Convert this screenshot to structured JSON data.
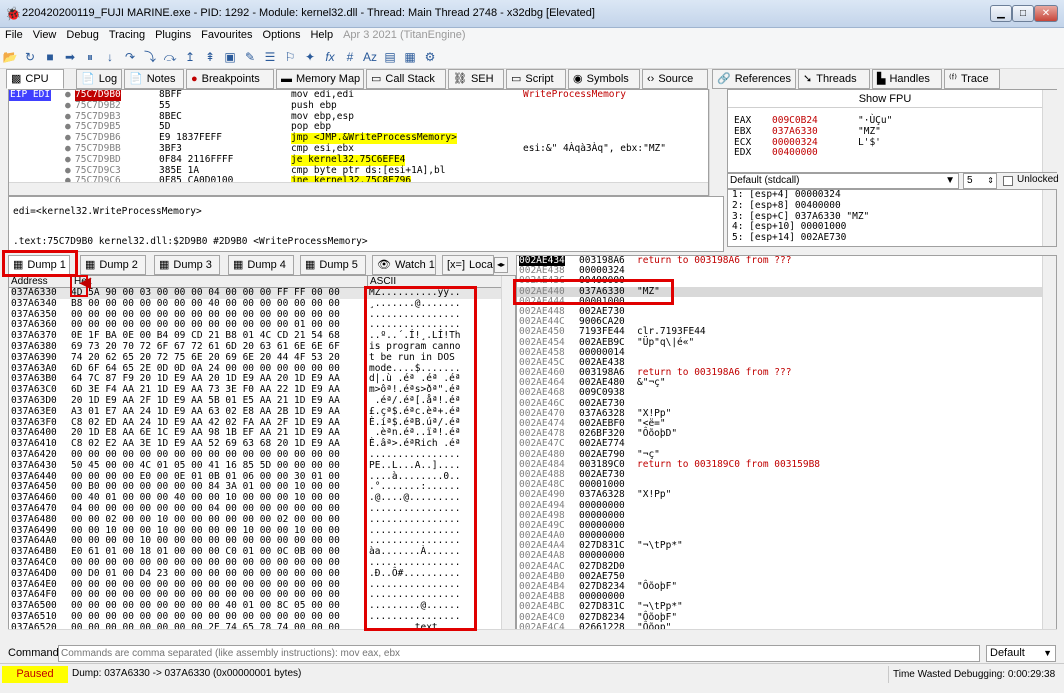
{
  "window": {
    "title": "220420200119_FUJI MARINE.exe - PID: 1292 - Module: kernel32.dll - Thread: Main Thread 2748 - x32dbg [Elevated]"
  },
  "menu": [
    "File",
    "View",
    "Debug",
    "Tracing",
    "Plugins",
    "Favourites",
    "Options",
    "Help"
  ],
  "menu_date": "Apr 3 2021 (TitanEngine)",
  "tabs": [
    "CPU",
    "Log",
    "Notes",
    "Breakpoints",
    "Memory Map",
    "Call Stack",
    "SEH",
    "Script",
    "Symbols",
    "Source",
    "References",
    "Threads",
    "Handles",
    "Trace"
  ],
  "disasm": [
    {
      "addr": "75C7D9B0",
      "bytes": "8BFF",
      "ins": "mov edi,edi",
      "comment": "WriteProcessMemory"
    },
    {
      "addr": "75C7D9B2",
      "bytes": "55",
      "ins": "push ebp",
      "comment": ""
    },
    {
      "addr": "75C7D9B3",
      "bytes": "8BEC",
      "ins": "mov ebp,esp",
      "comment": ""
    },
    {
      "addr": "75C7D9B5",
      "bytes": "5D",
      "ins": "pop ebp",
      "comment": ""
    },
    {
      "addr": "75C7D9B6",
      "bytes": "E9 1837FEFF",
      "ins": "jmp <JMP.&WriteProcessMemory>",
      "comment": ""
    },
    {
      "addr": "75C7D9BB",
      "bytes": "3BF3",
      "ins": "cmp esi,ebx",
      "comment": "esi:&\" 4Àqà3Àq\", ebx:\"MZ\""
    },
    {
      "addr": "75C7D9BD",
      "bytes": "0F84 2116FFFF",
      "ins": "je kernel32.75C6EFE4",
      "comment": ""
    },
    {
      "addr": "75C7D9C3",
      "bytes": "385E 1A",
      "ins": "cmp byte ptr ds:[esi+1A],bl",
      "comment": ""
    },
    {
      "addr": "75C7D9C6",
      "bytes": "0F85 CA0D0100",
      "ins": "jne kernel32.75C8E796",
      "comment": ""
    },
    {
      "addr": "75C7D9CC",
      "bytes": "FF76 14",
      "ins": "push dword ptr ds:[esi+14]",
      "comment": ""
    }
  ],
  "eip_label": "EIP EDI",
  "info_line1": "edi=<kernel32.WriteProcessMemory>",
  "info_line2": ".text:75C7D9B0 kernel32.dll:$2D9B0 #2D9B0 <WriteProcessMemory>",
  "regs": {
    "show_fpu": "Show FPU",
    "rows": [
      {
        "n": "EAX",
        "v": "009C0B24",
        "c": "\"·ÙÇu\""
      },
      {
        "n": "EBX",
        "v": "037A6330",
        "c": "\"MZ\""
      },
      {
        "n": "ECX",
        "v": "00000324",
        "c": "L'$'"
      },
      {
        "n": "EDX",
        "v": "00400000",
        "c": ""
      }
    ]
  },
  "callconv": {
    "label": "Default (stdcall)",
    "count": "5",
    "unlocked": "Unlocked"
  },
  "args": [
    "1: [esp+4] 00000324",
    "2: [esp+8] 00400000",
    "3: [esp+C] 037A6330 \"MZ\"",
    "4: [esp+10] 00001000",
    "5: [esp+14] 002AE730"
  ],
  "dumptabs": [
    "Dump 1",
    "Dump 2",
    "Dump 3",
    "Dump 4",
    "Dump 5",
    "Watch 1",
    "Loca"
  ],
  "dump_hdr": {
    "addr": "Address",
    "hex": "Hex",
    "ascii": "ASCII"
  },
  "dump": [
    {
      "a": "037A6330",
      "h": "4D 5A 90 00 03 00 00 00 04 00 00 00 FF FF 00 00",
      "s": "MZ..........ÿÿ.."
    },
    {
      "a": "037A6340",
      "h": "B8 00 00 00 00 00 00 00 40 00 00 00 00 00 00 00",
      "s": "¸.......@......."
    },
    {
      "a": "037A6350",
      "h": "00 00 00 00 00 00 00 00 00 00 00 00 00 00 00 00",
      "s": "................"
    },
    {
      "a": "037A6360",
      "h": "00 00 00 00 00 00 00 00 00 00 00 00 00 01 00 00",
      "s": "................"
    },
    {
      "a": "037A6370",
      "h": "0E 1F BA 0E 00 B4 09 CD 21 B8 01 4C CD 21 54 68",
      "s": "..º..´.Í!¸.LÍ!Th"
    },
    {
      "a": "037A6380",
      "h": "69 73 20 70 72 6F 67 72 61 6D 20 63 61 6E 6E 6F",
      "s": "is program canno"
    },
    {
      "a": "037A6390",
      "h": "74 20 62 65 20 72 75 6E 20 69 6E 20 44 4F 53 20",
      "s": "t be run in DOS "
    },
    {
      "a": "037A63A0",
      "h": "6D 6F 64 65 2E 0D 0D 0A 24 00 00 00 00 00 00 00",
      "s": "mode....$......."
    },
    {
      "a": "037A63B0",
      "h": "64 7C 87 F9 20 1D E9 AA 20 1D E9 AA 20 1D E9 AA",
      "s": "d|.ù .éª .éª .éª"
    },
    {
      "a": "037A63C0",
      "h": "6D 3E F4 AA 21 1D E9 AA 73 3E F0 AA 22 1D E9 AA",
      "s": "m>ôª!.éªs>ðª\".éª"
    },
    {
      "a": "037A63D0",
      "h": "20 1D E9 AA 2F 1D E9 AA 5B 01 E5 AA 21 1D E9 AA",
      "s": " .éª/.éª[.åª!.éª"
    },
    {
      "a": "037A63E0",
      "h": "A3 01 E7 AA 24 1D E9 AA 63 02 E8 AA 2B 1D E9 AA",
      "s": "£.çª$.éªc.èª+.éª"
    },
    {
      "a": "037A63F0",
      "h": "C8 02 ED AA 24 1D E9 AA 42 02 FA AA 2F 1D E9 AA",
      "s": "È.íª$.éªB.úª/.éª"
    },
    {
      "a": "037A6400",
      "h": "20 1D E8 AA 6E 1C E9 AA 98 1B EF AA 21 1D E9 AA",
      "s": " .èªn.éª..ïª!.éª"
    },
    {
      "a": "037A6410",
      "h": "C8 02 E2 AA 3E 1D E9 AA 52 69 63 68 20 1D E9 AA",
      "s": "È.âª>.éªRich .éª"
    },
    {
      "a": "037A6420",
      "h": "00 00 00 00 00 00 00 00 00 00 00 00 00 00 00 00",
      "s": "................"
    },
    {
      "a": "037A6430",
      "h": "50 45 00 00 4C 01 05 00 41 16 85 5D 00 00 00 00",
      "s": "PE..L...A..]...."
    },
    {
      "a": "037A6440",
      "h": "00 00 00 00 E0 00 0E 01 0B 01 06 00 00 30 01 00",
      "s": "....à........0.."
    },
    {
      "a": "037A6450",
      "h": "00 B0 00 00 00 00 00 00 84 3A 01 00 00 10 00 00",
      "s": ".°.......:......"
    },
    {
      "a": "037A6460",
      "h": "00 40 01 00 00 00 40 00 00 10 00 00 00 10 00 00",
      "s": ".@....@........."
    },
    {
      "a": "037A6470",
      "h": "04 00 00 00 00 00 00 00 04 00 00 00 00 00 00 00",
      "s": "................"
    },
    {
      "a": "037A6480",
      "h": "00 00 02 00 00 10 00 00 00 00 00 00 02 00 00 00",
      "s": "................"
    },
    {
      "a": "037A6490",
      "h": "00 00 10 00 00 10 00 00 00 00 10 00 00 10 00 00",
      "s": "................"
    },
    {
      "a": "037A64A0",
      "h": "00 00 00 00 10 00 00 00 00 00 00 00 00 00 00 00",
      "s": "................"
    },
    {
      "a": "037A64B0",
      "h": "E0 61 01 00 18 01 00 00 00 C0 01 00 0C 0B 00 00",
      "s": "àa.......À......"
    },
    {
      "a": "037A64C0",
      "h": "00 00 00 00 00 00 00 00 00 00 00 00 00 00 00 00",
      "s": "................"
    },
    {
      "a": "037A64D0",
      "h": "00 D0 01 00 D4 23 00 00 00 00 00 00 00 00 00 00",
      "s": ".Ð..Ô#.........."
    },
    {
      "a": "037A64E0",
      "h": "00 00 00 00 00 00 00 00 00 00 00 00 00 00 00 00",
      "s": "................"
    },
    {
      "a": "037A64F0",
      "h": "00 00 00 00 00 00 00 00 00 00 00 00 00 00 00 00",
      "s": "................"
    },
    {
      "a": "037A6500",
      "h": "00 00 00 00 00 00 00 00 00 40 01 00 8C 05 00 00",
      "s": ".........@......"
    },
    {
      "a": "037A6510",
      "h": "00 00 00 00 00 00 00 00 00 00 00 00 00 00 00 00",
      "s": "................"
    },
    {
      "a": "037A6520",
      "h": "00 00 00 00 00 00 00 00 2E 74 65 78 74 00 00 00",
      "s": "........text...."
    },
    {
      "a": "037A6530",
      "h": "26 2D 01 00 00 10 00 00 00 30 01 00 00 10 00 00",
      "s": "&-.......0......"
    },
    {
      "a": "037A6540",
      "h": "00 00 00 00 00 00 00 00 00 00 00 00 20 00 00 60",
      "s": "............ ..`"
    }
  ],
  "stack": [
    {
      "a": "002AE434",
      "v": "003198A6",
      "c": "return to 003198A6 from ???",
      "cls": "red",
      "sel": true
    },
    {
      "a": "002AE438",
      "v": "00000324",
      "c": ""
    },
    {
      "a": "002AE43C",
      "v": "00400000",
      "c": ""
    },
    {
      "a": "002AE440",
      "v": "037A6330",
      "c": "\"MZ\""
    },
    {
      "a": "002AE444",
      "v": "00001000",
      "c": ""
    },
    {
      "a": "002AE448",
      "v": "002AE730",
      "c": ""
    },
    {
      "a": "002AE44C",
      "v": "9006CA20",
      "c": ""
    },
    {
      "a": "002AE450",
      "v": "7193FE44",
      "c": "clr.7193FE44"
    },
    {
      "a": "002AE454",
      "v": "002AEB9C",
      "c": "\"Üp\"q\\|é«\""
    },
    {
      "a": "002AE458",
      "v": "00000014",
      "c": ""
    },
    {
      "a": "002AE45C",
      "v": "002AE438",
      "c": ""
    },
    {
      "a": "002AE460",
      "v": "003198A6",
      "c": "return to 003198A6 from ???",
      "cls": "red"
    },
    {
      "a": "002AE464",
      "v": "002AE480",
      "c": "&\"¬ç\""
    },
    {
      "a": "002AE468",
      "v": "009C0938",
      "c": ""
    },
    {
      "a": "002AE46C",
      "v": "002AE730",
      "c": ""
    },
    {
      "a": "002AE470",
      "v": "037A6328",
      "c": "\"X!Pp\""
    },
    {
      "a": "002AE474",
      "v": "002AEBF0",
      "c": "\"<ë=\""
    },
    {
      "a": "002AE478",
      "v": "026BF320",
      "c": "\"ÔõoþD\""
    },
    {
      "a": "002AE47C",
      "v": "002AE774",
      "c": ""
    },
    {
      "a": "002AE480",
      "v": "002AE790",
      "c": "\"¬ç\""
    },
    {
      "a": "002AE484",
      "v": "003189C0",
      "c": "return to 003189C0 from 003159B8",
      "cls": "red"
    },
    {
      "a": "002AE488",
      "v": "002AE730",
      "c": ""
    },
    {
      "a": "002AE48C",
      "v": "00001000",
      "c": ""
    },
    {
      "a": "002AE490",
      "v": "037A6328",
      "c": "\"X!Pp\""
    },
    {
      "a": "002AE494",
      "v": "00000000",
      "c": ""
    },
    {
      "a": "002AE498",
      "v": "00000000",
      "c": ""
    },
    {
      "a": "002AE49C",
      "v": "00000000",
      "c": ""
    },
    {
      "a": "002AE4A0",
      "v": "00000000",
      "c": ""
    },
    {
      "a": "002AE4A4",
      "v": "027D831C",
      "c": "\"¬\\tPp*\""
    },
    {
      "a": "002AE4A8",
      "v": "00000000",
      "c": ""
    },
    {
      "a": "002AE4AC",
      "v": "027D82D0",
      "c": ""
    },
    {
      "a": "002AE4B0",
      "v": "002AE750",
      "c": ""
    },
    {
      "a": "002AE4B4",
      "v": "027D8234",
      "c": "\"ÔõoþF\""
    },
    {
      "a": "002AE4B8",
      "v": "00000000",
      "c": ""
    },
    {
      "a": "002AE4BC",
      "v": "027D831C",
      "c": "\"¬\\tPp*\""
    },
    {
      "a": "002AE4C0",
      "v": "027D8234",
      "c": "\"ÔõoþF\""
    },
    {
      "a": "002AE4C4",
      "v": "02661228",
      "c": "\"Ôõop\""
    },
    {
      "a": "002AE4C8",
      "v": "026BF320",
      "c": "\"ÔõoþD\""
    }
  ],
  "command": {
    "label": "Command:",
    "placeholder": "Commands are comma separated (like assembly instructions): mov eax, ebx",
    "mode": "Default"
  },
  "status": {
    "state": "Paused",
    "msg": "Dump: 037A6330 -> 037A6330 (0x00000001 bytes)",
    "time": "Time Wasted Debugging: 0:00:29:38"
  }
}
